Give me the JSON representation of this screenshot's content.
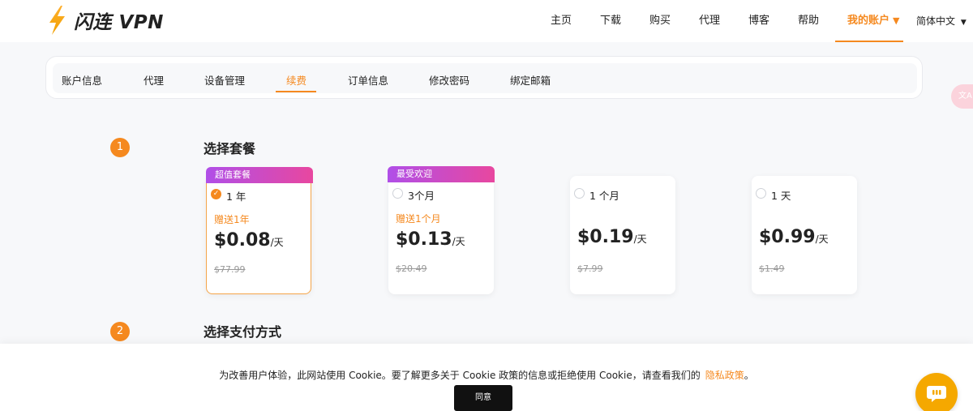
{
  "brand": {
    "name": "闪连 VPN"
  },
  "nav": {
    "items": [
      "主页",
      "下载",
      "购买",
      "代理",
      "博客",
      "帮助"
    ],
    "account_label": "我的账户",
    "language_label": "简体中文"
  },
  "tabs": [
    "账户信息",
    "代理",
    "设备管理",
    "续费",
    "订单信息",
    "修改密码",
    "绑定邮箱"
  ],
  "active_tab_index": 3,
  "translate": {
    "label": "文A"
  },
  "steps": [
    {
      "number": "1",
      "title": "选择套餐"
    },
    {
      "number": "2",
      "title": "选择支付方式"
    }
  ],
  "plans": [
    {
      "badge": "超值套餐",
      "name": "1 年",
      "bonus": "赠送1年",
      "price": "$0.08",
      "unit": "/天",
      "original": "$77.99",
      "selected": true
    },
    {
      "badge": "最受欢迎",
      "name": "3个月",
      "bonus": "赠送1个月",
      "price": "$0.13",
      "unit": "/天",
      "original": "$20.49",
      "selected": false
    },
    {
      "badge": "",
      "name": "1 个月",
      "bonus": "",
      "price": "$0.19",
      "unit": "/天",
      "original": "$7.99",
      "selected": false
    },
    {
      "badge": "",
      "name": "1 天",
      "bonus": "",
      "price": "$0.99",
      "unit": "/天",
      "original": "$1.49",
      "selected": false
    }
  ],
  "cookie": {
    "text": "为改善用户体验，此网站使用 Cookie。要了解更多关于 Cookie 政策的信息或拒绝使用 Cookie，请查看我们的",
    "link": "隐私政策",
    "suffix": "。",
    "agree": "同意"
  },
  "colors": {
    "accent": "#f5891f",
    "badge_gradient_start": "#b04fe8",
    "badge_gradient_end": "#e8479f"
  },
  "icons": {
    "brand": "lightning-bolt-icon",
    "translate": "translate-icon",
    "chat": "chat-bubble-icon",
    "checked": "check-icon"
  }
}
